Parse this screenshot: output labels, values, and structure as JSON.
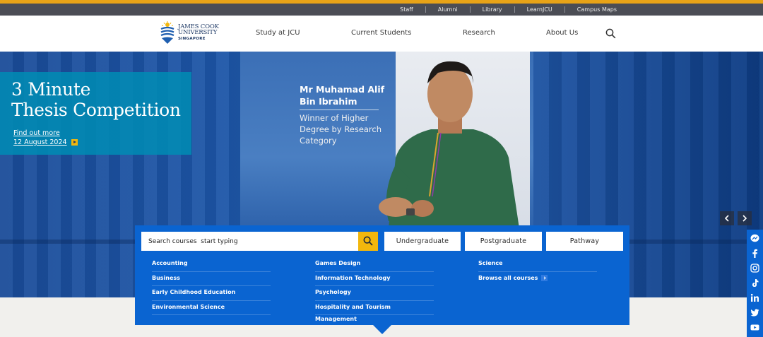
{
  "utility_nav": {
    "items": [
      "Staff",
      "Alumni",
      "Library",
      "LearnJCU",
      "Campus Maps"
    ]
  },
  "logo": {
    "line1": "JAMES COOK",
    "line2": "UNIVERSITY",
    "line3": "SINGAPORE"
  },
  "main_nav": {
    "items": [
      "Study at JCU",
      "Current Students",
      "Research",
      "About Us"
    ]
  },
  "hero": {
    "feature_title_line1": "3 Minute",
    "feature_title_line2": "Thesis Competition",
    "link_text": "Find out more",
    "date": "12 August 2024",
    "caption_name_line1": "Mr Muhamad Alif",
    "caption_name_line2": "Bin Ibrahim",
    "caption_desc_line1": "Winner of Higher",
    "caption_desc_line2": "Degree by Research",
    "caption_desc_line3": "Category"
  },
  "course_search": {
    "placeholder": "Search courses  start typing",
    "levels": [
      "Undergraduate",
      "Postgraduate",
      "Pathway"
    ],
    "columns": [
      [
        "Accounting",
        "Business",
        "Early Childhood Education",
        "Environmental Science"
      ],
      [
        "Games Design",
        "Information Technology",
        "Psychology",
        "Hospitality and Tourism Management"
      ],
      [
        "Science"
      ]
    ],
    "browse_all": "Browse all courses"
  },
  "social": [
    "messenger-icon",
    "facebook-icon",
    "instagram-icon",
    "tiktok-icon",
    "linkedin-icon",
    "twitter-icon",
    "youtube-icon"
  ],
  "colors": {
    "gold": "#e8a317",
    "utility_bg": "#4b4d55",
    "panel_blue": "#0a64d1",
    "feature_teal": "#008cb4",
    "search_button": "#f2b70d"
  }
}
